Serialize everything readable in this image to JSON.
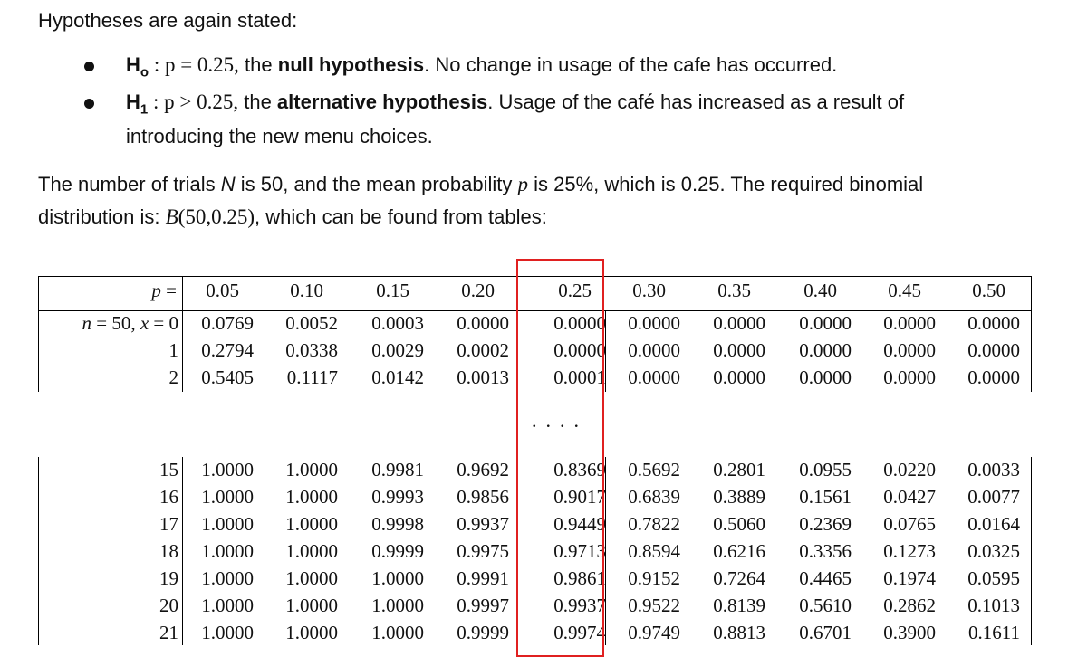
{
  "intro": "Hypotheses are again stated:",
  "h0": {
    "label": "H",
    "sub": "o",
    "math": " : p = 0.25,",
    "pre": " the ",
    "bold": "null hypothesis",
    "post": ".  No change in usage of the cafe has occurred."
  },
  "h1": {
    "label": "H",
    "sub": "1",
    "math": " : p > 0.25,",
    "pre": " the ",
    "bold": "alternative hypothesis",
    "post": ".  Usage of the café has increased as a result of",
    "line2": "introducing the new menu choices."
  },
  "para": {
    "l1a": "The number of trials ",
    "n": "N",
    "l1b": " is 50, and the mean probability ",
    "p": "p",
    "l1c": " is 25%, which is 0.25. The required binomial",
    "l2a": "distribution is:  ",
    "dist": "B",
    "distargs": "(50,0.25)",
    "l2b": ",  which can be found from tables:"
  },
  "table": {
    "p_header": "p =",
    "n_header": "n = 50, x = ",
    "columns": [
      "0.05",
      "0.10",
      "0.15",
      "0.20",
      "0.25",
      "0.30",
      "0.35",
      "0.40",
      "0.45",
      "0.50"
    ],
    "top_rows": [
      {
        "x": "0",
        "values": [
          "0.0769",
          "0.0052",
          "0.0003",
          "0.0000",
          "0.0000",
          "0.0000",
          "0.0000",
          "0.0000",
          "0.0000",
          "0.0000"
        ]
      },
      {
        "x": "1",
        "values": [
          "0.2794",
          "0.0338",
          "0.0029",
          "0.0002",
          "0.0000",
          "0.0000",
          "0.0000",
          "0.0000",
          "0.0000",
          "0.0000"
        ]
      },
      {
        "x": "2",
        "values": [
          "0.5405",
          "0.1117",
          "0.0142",
          "0.0013",
          "0.0001",
          "0.0000",
          "0.0000",
          "0.0000",
          "0.0000",
          "0.0000"
        ]
      }
    ],
    "ellipsis": "....",
    "bottom_rows": [
      {
        "x": "15",
        "values": [
          "1.0000",
          "1.0000",
          "0.9981",
          "0.9692",
          "0.8369",
          "0.5692",
          "0.2801",
          "0.0955",
          "0.0220",
          "0.0033"
        ]
      },
      {
        "x": "16",
        "values": [
          "1.0000",
          "1.0000",
          "0.9993",
          "0.9856",
          "0.9017",
          "0.6839",
          "0.3889",
          "0.1561",
          "0.0427",
          "0.0077"
        ]
      },
      {
        "x": "17",
        "values": [
          "1.0000",
          "1.0000",
          "0.9998",
          "0.9937",
          "0.9449",
          "0.7822",
          "0.5060",
          "0.2369",
          "0.0765",
          "0.0164"
        ]
      },
      {
        "x": "18",
        "values": [
          "1.0000",
          "1.0000",
          "0.9999",
          "0.9975",
          "0.9713",
          "0.8594",
          "0.6216",
          "0.3356",
          "0.1273",
          "0.0325"
        ]
      },
      {
        "x": "19",
        "values": [
          "1.0000",
          "1.0000",
          "1.0000",
          "0.9991",
          "0.9861",
          "0.9152",
          "0.7264",
          "0.4465",
          "0.1974",
          "0.0595"
        ]
      },
      {
        "x": "20",
        "values": [
          "1.0000",
          "1.0000",
          "1.0000",
          "0.9997",
          "0.9937",
          "0.9522",
          "0.8139",
          "0.5610",
          "0.2862",
          "0.1013"
        ]
      },
      {
        "x": "21",
        "values": [
          "1.0000",
          "1.0000",
          "1.0000",
          "0.9999",
          "0.9974",
          "0.9749",
          "0.8813",
          "0.6701",
          "0.3900",
          "0.1611"
        ]
      }
    ],
    "highlight_color": "#e02020"
  }
}
